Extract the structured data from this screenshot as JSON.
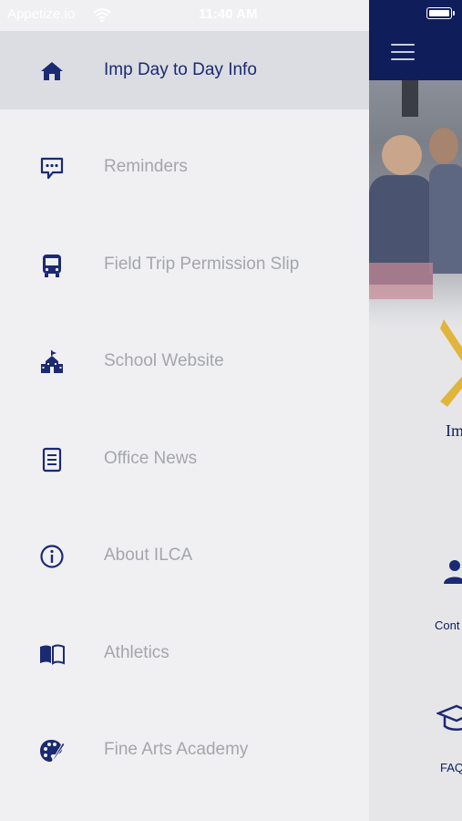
{
  "status_bar": {
    "carrier": "Appetize.io",
    "time": "11:40 AM"
  },
  "colors": {
    "accent": "#1b2a73",
    "header": "#0f1d5a",
    "inactive_text": "#a4a6ab",
    "active_bg": "#dcdde2"
  },
  "drawer": {
    "items": [
      {
        "label": "Imp Day to Day Info",
        "icon": "home-icon",
        "active": true
      },
      {
        "label": "Reminders",
        "icon": "chat-bubble-icon",
        "active": false
      },
      {
        "label": "Field Trip Permission Slip",
        "icon": "bus-icon",
        "active": false
      },
      {
        "label": "School Website",
        "icon": "school-icon",
        "active": false
      },
      {
        "label": "Office News",
        "icon": "document-icon",
        "active": false
      },
      {
        "label": "About ILCA",
        "icon": "info-icon",
        "active": false
      },
      {
        "label": "Athletics",
        "icon": "book-icon",
        "active": false
      },
      {
        "label": "Fine Arts Academy",
        "icon": "palette-icon",
        "active": false
      }
    ]
  },
  "background_app": {
    "logo_text": "Im",
    "tile_1_label": "Cont",
    "tile_2_label": "FAQ"
  }
}
